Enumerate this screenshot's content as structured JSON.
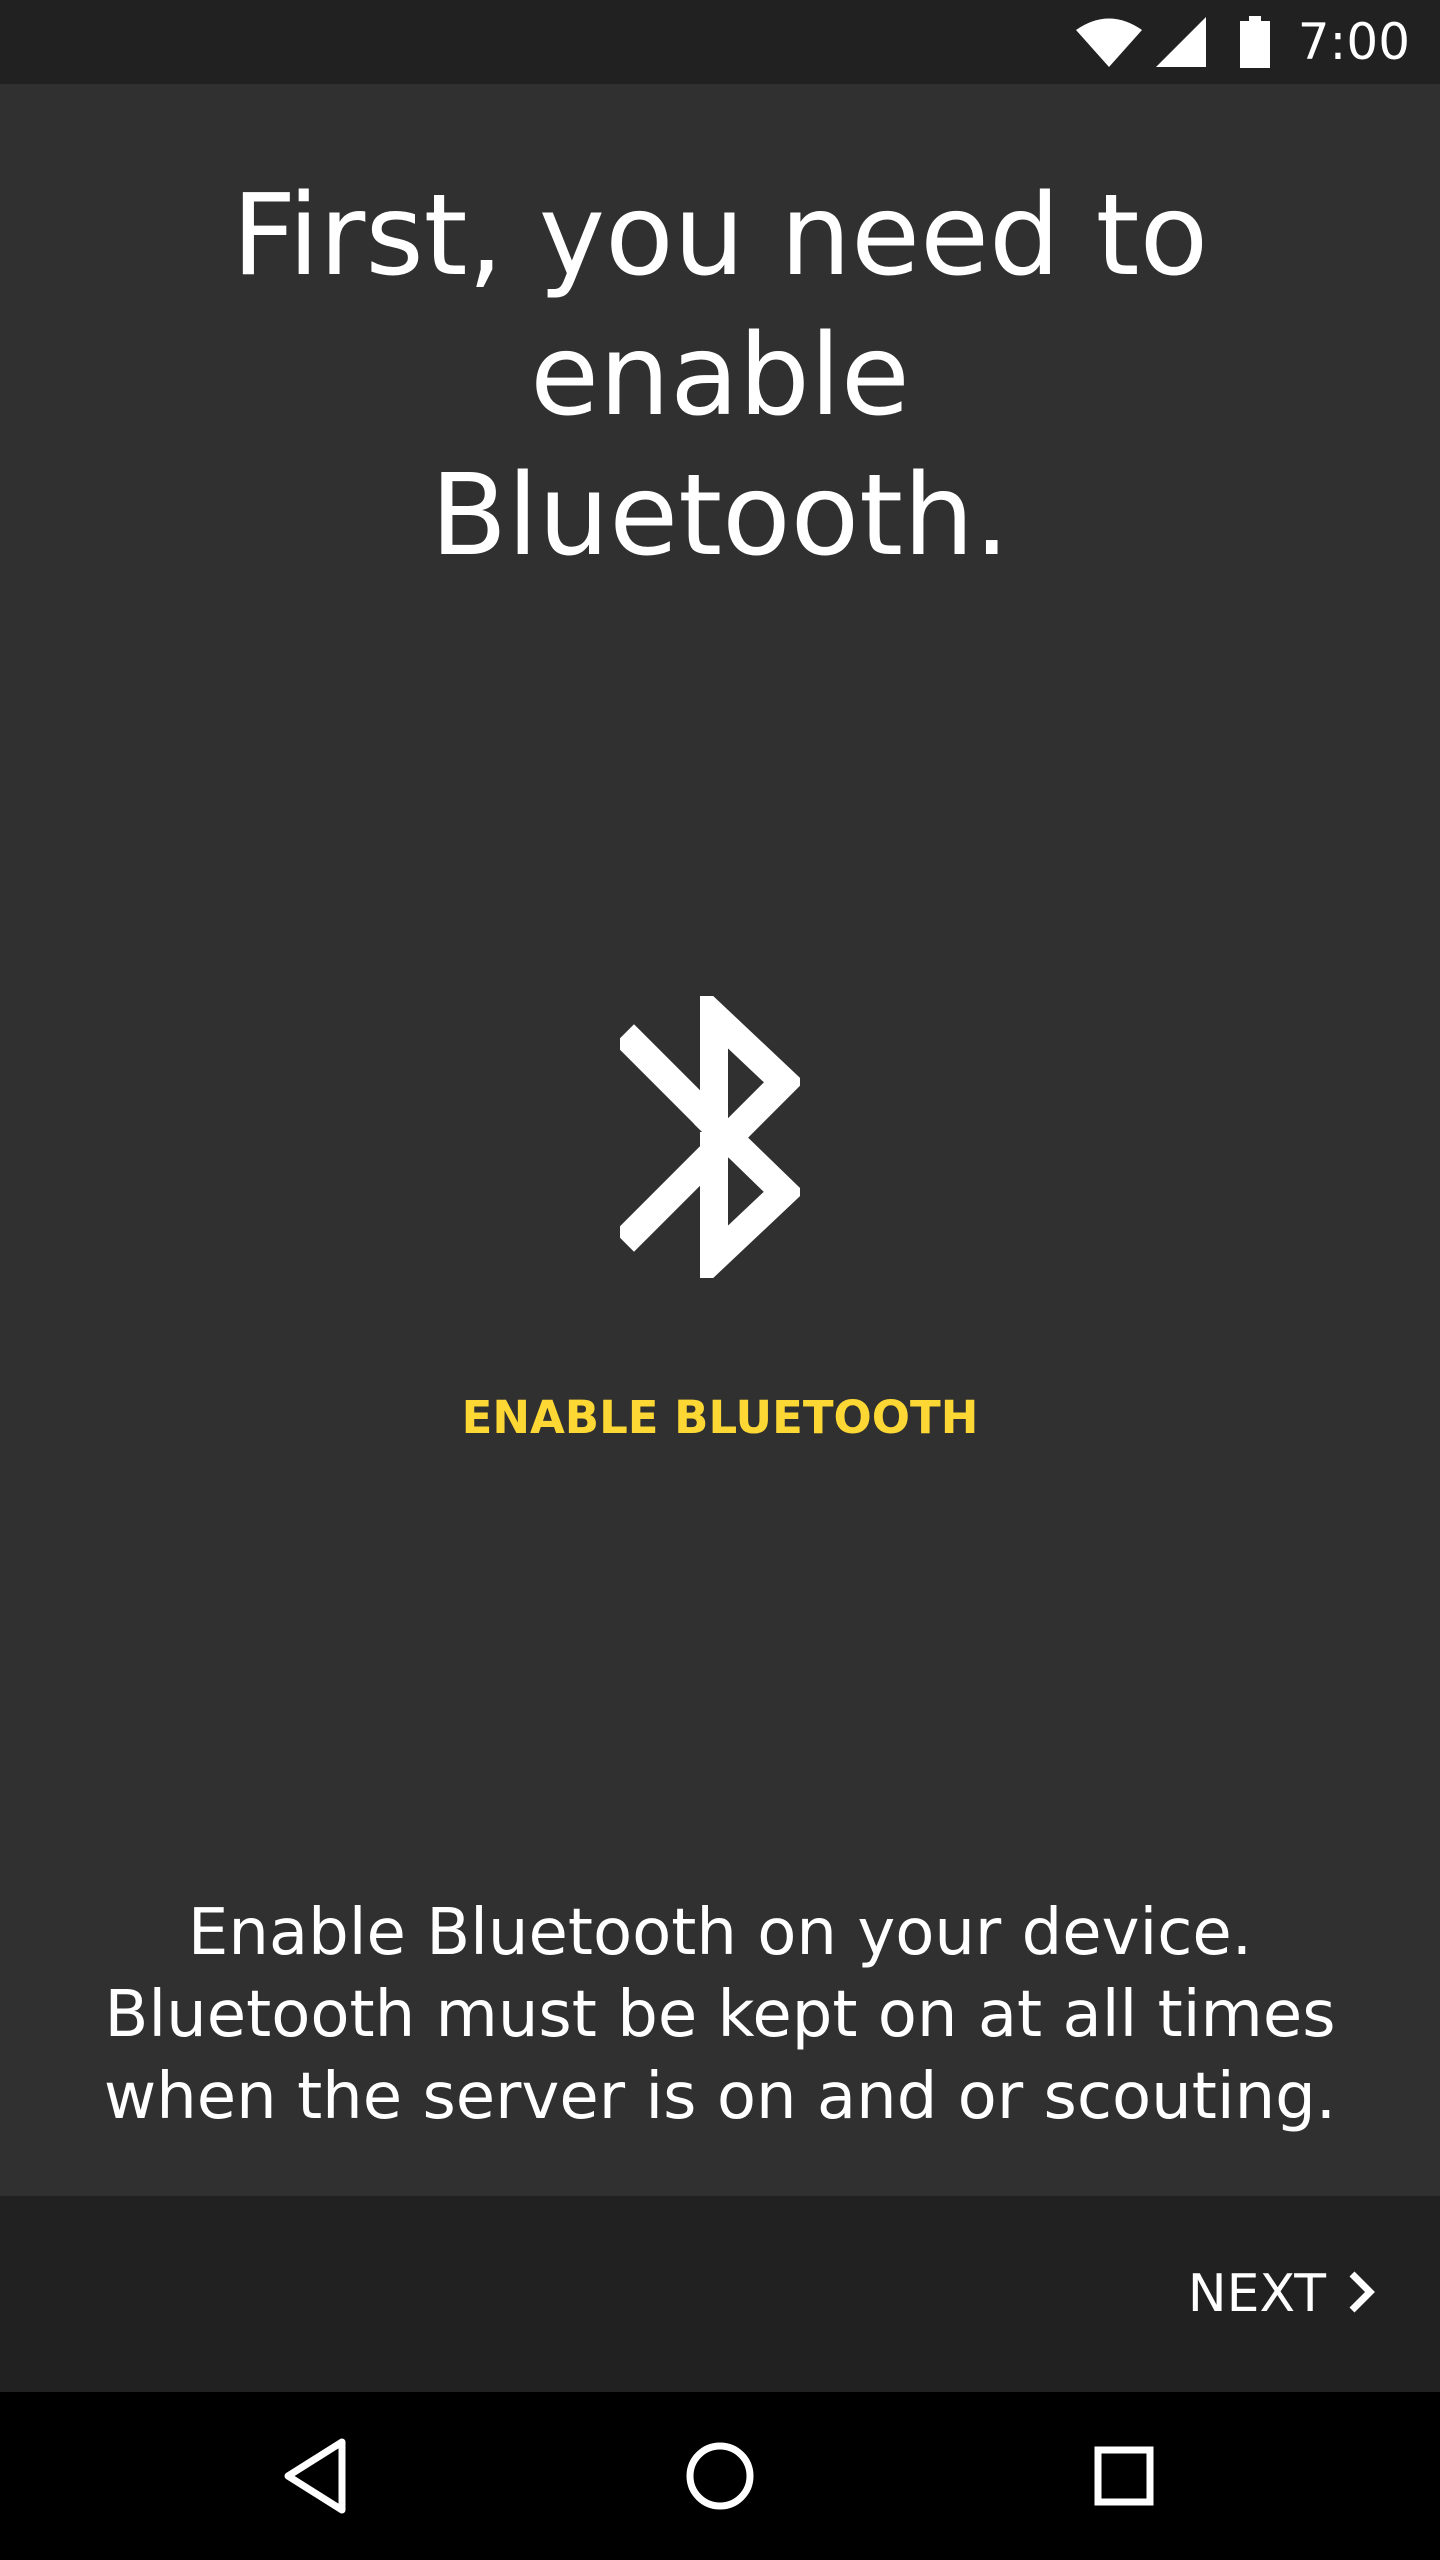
{
  "status_bar": {
    "time": "7:00",
    "icons": [
      "wifi-icon",
      "cell-signal-icon",
      "battery-icon"
    ]
  },
  "page": {
    "title_line1": "First, you need to enable",
    "title_line2": "Bluetooth.",
    "icon": "bluetooth-icon",
    "enable_button_label": "ENABLE BLUETOOTH",
    "description_line1": "Enable Bluetooth on your device.",
    "description_line2": "Bluetooth must be kept on at all times",
    "description_line3": "when the server is on and or scouting."
  },
  "bottom_bar": {
    "next_label": "NEXT",
    "next_icon": "chevron-right-icon"
  },
  "nav_bar": {
    "icons": [
      "back-icon",
      "home-icon",
      "recents-icon"
    ]
  },
  "colors": {
    "background": "#303030",
    "bars": "#212121",
    "accent": "#fdd835",
    "text": "#ffffff"
  }
}
